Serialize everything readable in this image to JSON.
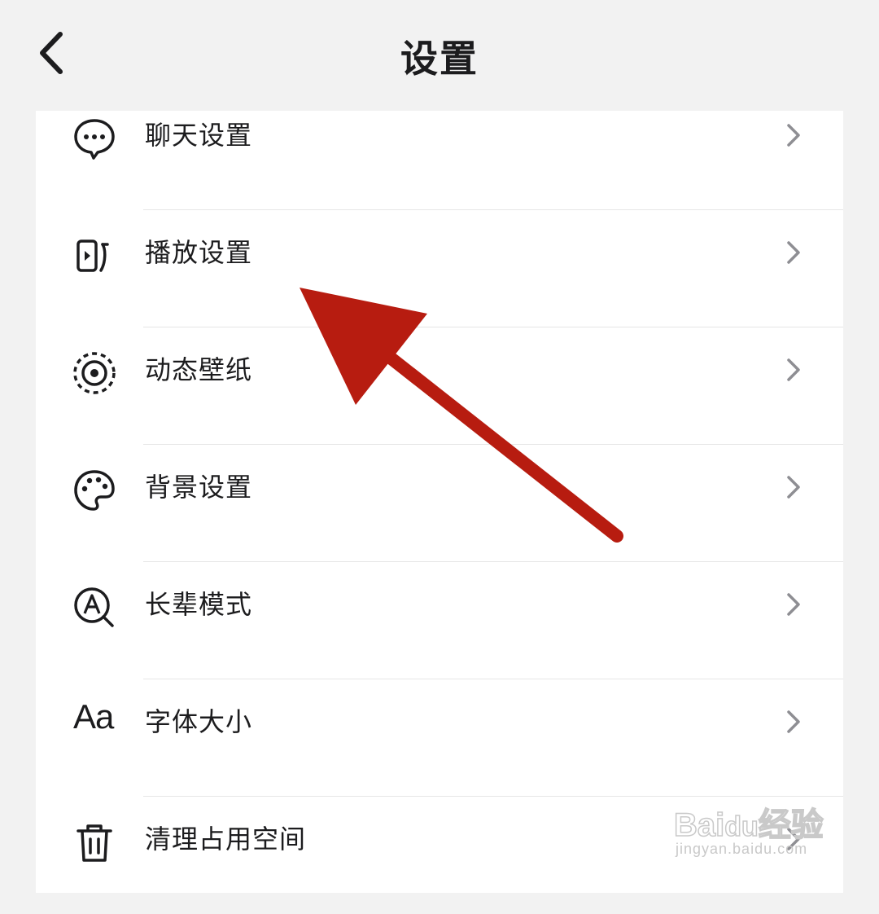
{
  "header": {
    "title": "设置",
    "back_icon": "chevron-left-icon"
  },
  "menu": [
    {
      "label": "聊天设置",
      "icon": "chat-bubble-icon"
    },
    {
      "label": "播放设置",
      "icon": "playback-icon"
    },
    {
      "label": "动态壁纸",
      "icon": "dynamic-wallpaper-icon"
    },
    {
      "label": "背景设置",
      "icon": "palette-icon"
    },
    {
      "label": "长辈模式",
      "icon": "elder-mode-icon"
    },
    {
      "label": "字体大小",
      "icon": "font-size-icon",
      "icon_text": "Aa"
    },
    {
      "label": "清理占用空间",
      "icon": "trash-icon"
    }
  ],
  "annotation": {
    "arrow_color": "#b71c10"
  },
  "watermark": {
    "brand": "Bai",
    "brand_cn": "经验",
    "url": "jingyan.baidu.com"
  }
}
